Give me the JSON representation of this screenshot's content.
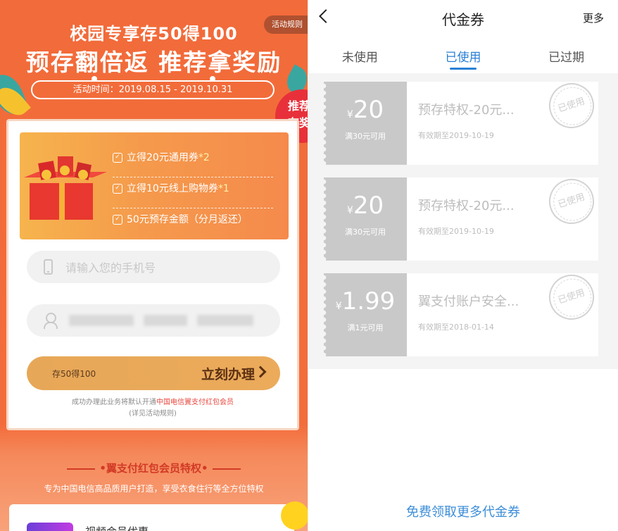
{
  "left": {
    "rules_tab": "活动规则",
    "title_line1": "校园专享存50得100",
    "title_line2": "预存翻倍返 推荐拿奖励",
    "activity_period": "活动时间：2019.08.15 - 2019.10.31",
    "recommend_badge": [
      "推荐",
      "有奖"
    ],
    "gifts": [
      {
        "text": "立得20元通用券",
        "suffix": "*2"
      },
      {
        "text": "立得10元线上购物券",
        "suffix": "*1"
      },
      {
        "text": "50元预存金额（分月返还）",
        "suffix": ""
      }
    ],
    "phone_placeholder": "请输入您的手机号",
    "submit": {
      "small": "存50得100",
      "big": "立刻办理"
    },
    "note_prefix": "成功办理此业务将默认开通",
    "note_highlight": "中国电信翼支付红包会员",
    "note_suffix": "(详见活动规则)",
    "member_title": "翼支付红包会员特权",
    "member_subtitle": "专为中国电信高品质用户打造，享受衣食住行等全方位特权",
    "member_card_text": "视频会员优惠"
  },
  "right": {
    "nav_title": "代金券",
    "nav_more": "更多",
    "tabs": [
      {
        "label": "未使用",
        "active": false
      },
      {
        "label": "已使用",
        "active": true
      },
      {
        "label": "已过期",
        "active": false
      }
    ],
    "coupons": [
      {
        "currency": "¥",
        "amount": "20",
        "condition": "满30元可用",
        "name": "预存特权-20元...",
        "expiry": "有效期至2019-10-19",
        "stamp": "已使用"
      },
      {
        "currency": "¥",
        "amount": "20",
        "condition": "满30元可用",
        "name": "预存特权-20元...",
        "expiry": "有效期至2019-10-19",
        "stamp": "已使用"
      },
      {
        "currency": "¥",
        "amount": "1.99",
        "condition": "满1元可用",
        "name": "翼支付账户安全...",
        "expiry": "有效期至2018-01-14",
        "stamp": "已使用"
      }
    ],
    "free_link": "免费领取更多代金券"
  },
  "colors": {
    "accent_orange": "#f26b3a",
    "tab_active": "#2a80d5",
    "link_blue": "#3d8ed8",
    "stub_gray": "#c9c9c9"
  }
}
